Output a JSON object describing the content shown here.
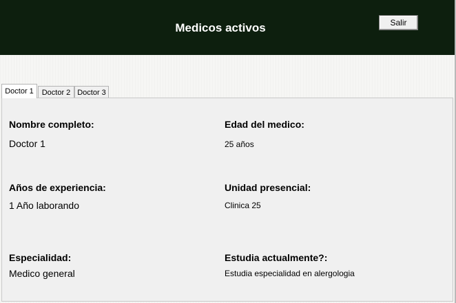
{
  "header": {
    "title": "Medicos activos",
    "exit_label": "Salir",
    "background_color": "#0d1f0e"
  },
  "tabs": [
    {
      "label": "Doctor 1",
      "active": true
    },
    {
      "label": "Doctor 2",
      "active": false
    },
    {
      "label": "Doctor 3",
      "active": false
    }
  ],
  "doctor": {
    "name_label": "Nombre completo:",
    "name_value": "Doctor 1",
    "age_label": "Edad del medico:",
    "age_value": "25 años",
    "experience_label": "Años de experiencia:",
    "experience_value": "1 Año laborando",
    "unit_label": "Unidad presencial:",
    "unit_value": "Clinica 25",
    "specialty_label": "Especialidad:",
    "specialty_value": "Medico general",
    "studying_label": "Estudia actualmente?:",
    "studying_value": "Estudia especialidad en alergologia"
  }
}
